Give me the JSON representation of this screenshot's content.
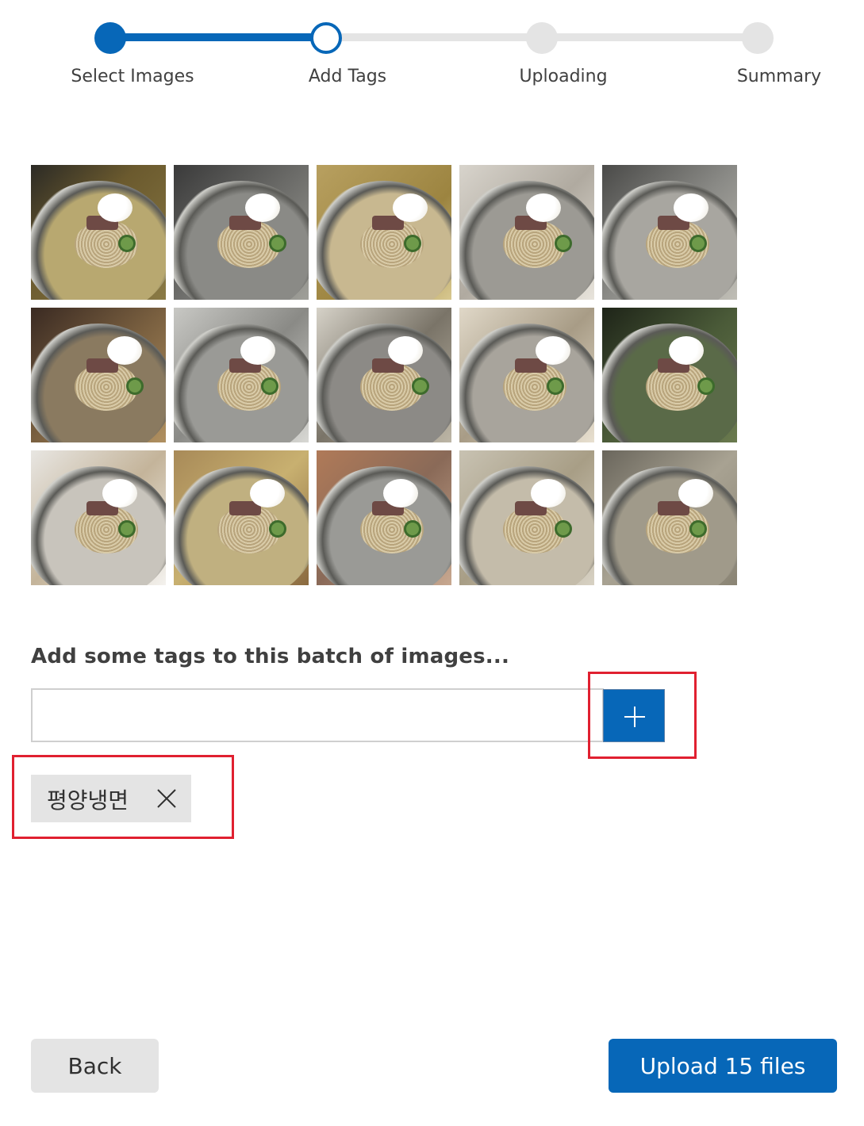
{
  "stepper": {
    "steps": [
      {
        "label": "Select Images",
        "state": "done"
      },
      {
        "label": "Add Tags",
        "state": "current"
      },
      {
        "label": "Uploading",
        "state": "todo"
      },
      {
        "label": "Summary",
        "state": "todo"
      }
    ],
    "accent_color": "#0767b8"
  },
  "images": [
    {
      "name": "image-1"
    },
    {
      "name": "image-2"
    },
    {
      "name": "image-3"
    },
    {
      "name": "image-4"
    },
    {
      "name": "image-5"
    },
    {
      "name": "image-6"
    },
    {
      "name": "image-7"
    },
    {
      "name": "image-8"
    },
    {
      "name": "image-9"
    },
    {
      "name": "image-10"
    },
    {
      "name": "image-11"
    },
    {
      "name": "image-12"
    },
    {
      "name": "image-13"
    },
    {
      "name": "image-14"
    },
    {
      "name": "image-15"
    }
  ],
  "tags": {
    "heading": "Add some tags to this batch of images...",
    "input_value": "",
    "add_icon": "plus-icon",
    "items": [
      {
        "label": "평양냉면",
        "remove_icon": "close-icon"
      }
    ]
  },
  "footer": {
    "back_label": "Back",
    "upload_label": "Upload 15 files"
  }
}
